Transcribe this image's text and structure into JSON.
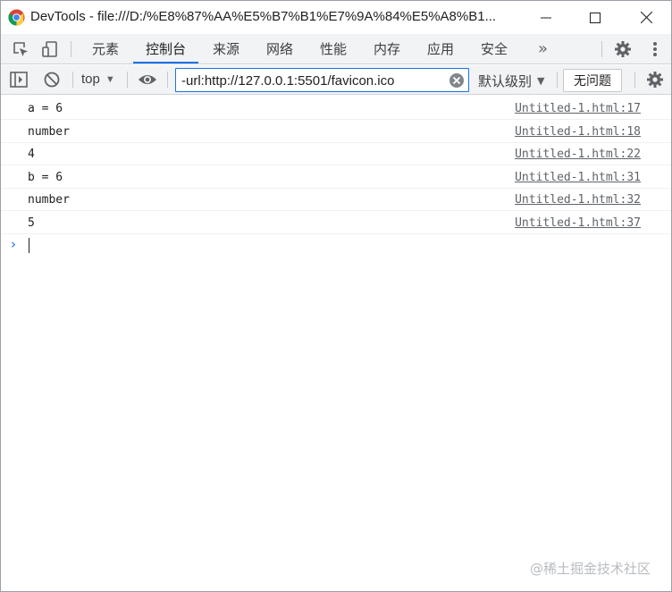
{
  "window": {
    "title": "DevTools - file:///D:/%E8%87%AA%E5%B7%B1%E7%9A%84%E5%A8%B1..."
  },
  "tabs": [
    {
      "label": "元素"
    },
    {
      "label": "控制台",
      "active": true
    },
    {
      "label": "来源"
    },
    {
      "label": "网络"
    },
    {
      "label": "性能"
    },
    {
      "label": "内存"
    },
    {
      "label": "应用"
    },
    {
      "label": "安全"
    }
  ],
  "toolbar": {
    "context": "top",
    "filter_value": "-url:http://127.0.0.1:5501/favicon.ico",
    "level": "默认级别",
    "issues": "无问题"
  },
  "console": {
    "messages": [
      {
        "text": "a = 6",
        "source": "Untitled-1.html:17"
      },
      {
        "text": "number",
        "source": "Untitled-1.html:18"
      },
      {
        "text": "4",
        "source": "Untitled-1.html:22"
      },
      {
        "text": "b = 6",
        "source": "Untitled-1.html:31"
      },
      {
        "text": "number",
        "source": "Untitled-1.html:32"
      },
      {
        "text": "5",
        "source": "Untitled-1.html:37"
      }
    ]
  },
  "watermark": "@稀土掘金技术社区",
  "colors": {
    "accent": "#1a73e8",
    "toolbar_bg": "#f1f3f4"
  }
}
